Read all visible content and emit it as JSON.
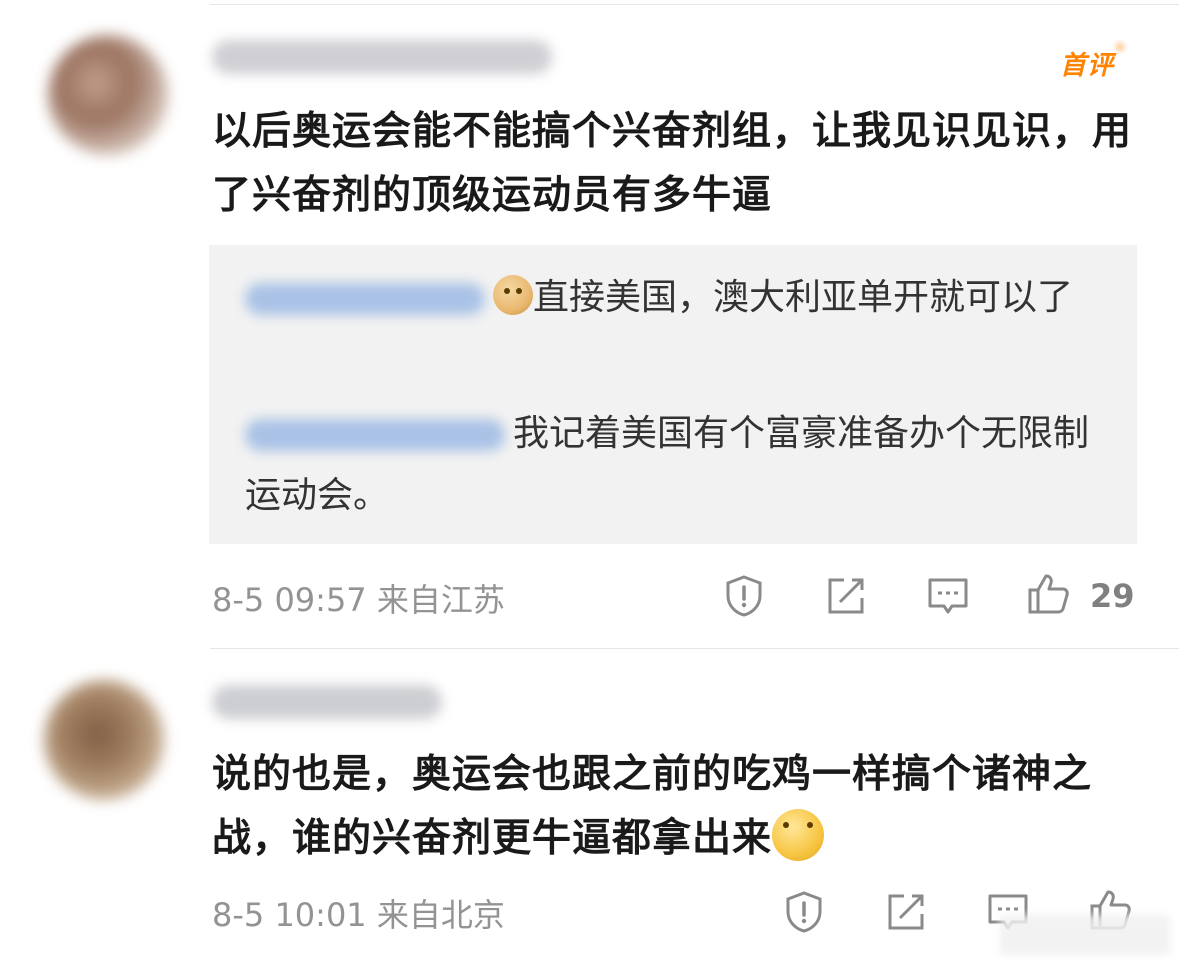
{
  "comments": [
    {
      "badge": "首评",
      "text": "以后奥运会能不能搞个兴奋剂组，让我见识见识，用了兴奋剂的顶级运动员有多牛逼",
      "replies": [
        {
          "text": "直接美国，澳大利亚单开就可以了",
          "emoji": "doge-icon"
        },
        {
          "text": "我记着美国有个富豪准备办个无限制运动会。"
        }
      ],
      "time": "8-5 09:57",
      "location": "来自江苏",
      "likes": "29"
    },
    {
      "text": "说的也是，奥运会也跟之前的吃鸡一样搞个诸神之战，谁的兴奋剂更牛逼都拿出来",
      "emoji": "thinking-face-icon",
      "time": "8-5 10:01",
      "location": "来自北京"
    }
  ],
  "colors": {
    "badge": "#ff8200",
    "meta": "#939393",
    "reply_bg": "#f2f2f2",
    "icon": "#8a8a8a"
  }
}
